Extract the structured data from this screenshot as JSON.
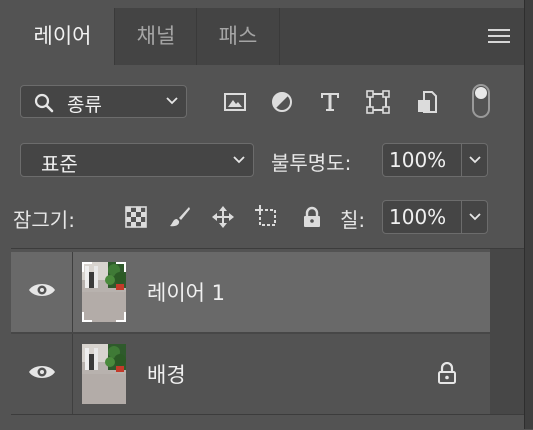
{
  "tabs": [
    {
      "label": "레이어",
      "active": true
    },
    {
      "label": "채널",
      "active": false
    },
    {
      "label": "패스",
      "active": false
    }
  ],
  "filter": {
    "kind_label": "종류",
    "icons": [
      "image-filter-icon",
      "adjustment-filter-icon",
      "type-filter-icon",
      "shape-filter-icon",
      "smart-object-filter-icon"
    ]
  },
  "blend": {
    "mode": "표준",
    "opacity_label": "불투명도:",
    "opacity_value": "100%"
  },
  "lock": {
    "label": "잠그기:",
    "icons": [
      "lock-transparent-pixels-icon",
      "lock-image-pixels-icon",
      "lock-position-icon",
      "lock-artboard-icon",
      "lock-all-icon"
    ],
    "fill_label": "칠:",
    "fill_value": "100%"
  },
  "layers": [
    {
      "name": "레이어 1",
      "selected": true,
      "visible": true,
      "locked": false
    },
    {
      "name": "배경",
      "selected": false,
      "visible": true,
      "locked": true
    }
  ],
  "colors": {
    "panel_bg": "#535353",
    "selected_layer_bg": "#696969",
    "tab_bar_bg": "#444444"
  }
}
